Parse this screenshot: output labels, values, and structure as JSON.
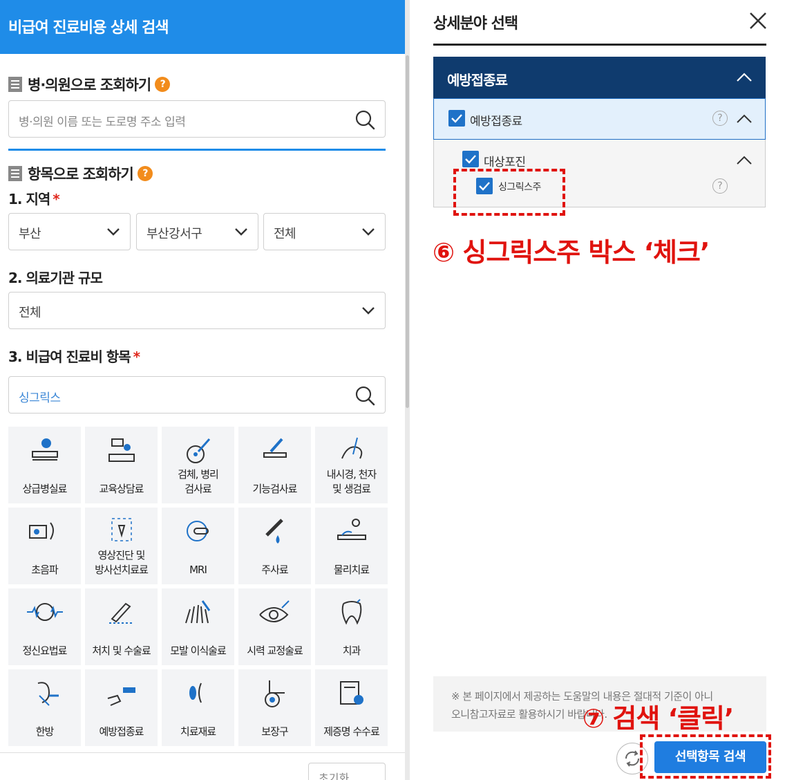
{
  "header": {
    "title": "비급여 진료비용 상세 검색"
  },
  "section1": {
    "title": "병·의원으로 조회하기",
    "help": "?",
    "search_placeholder": "병·의원 이름 또는 도로명 주소 입력"
  },
  "section2": {
    "title": "항목으로 조회하기",
    "help": "?",
    "region_label": "1. 지역",
    "required": "*",
    "region_selects": [
      "부산",
      "부산강서구",
      "전체"
    ],
    "scale_label": "2. 의료기관 규모",
    "scale_value": "전체",
    "item_label": "3. 비급여 진료비 항목",
    "item_value": "싱그릭스"
  },
  "categories": [
    {
      "label": "상급병실료",
      "icon": "bed-icon"
    },
    {
      "label": "교육상담료",
      "icon": "consult-icon"
    },
    {
      "label": "검체, 병리\n검사료",
      "icon": "specimen-icon"
    },
    {
      "label": "기능검사료",
      "icon": "function-test-icon"
    },
    {
      "label": "내시경, 천자\n및 생검료",
      "icon": "endoscope-icon"
    },
    {
      "label": "초음파",
      "icon": "ultrasound-icon"
    },
    {
      "label": "영상진단 및\n방사선치료료",
      "icon": "xray-icon"
    },
    {
      "label": "MRI",
      "icon": "mri-icon"
    },
    {
      "label": "주사료",
      "icon": "syringe-icon"
    },
    {
      "label": "물리치료",
      "icon": "physio-icon"
    },
    {
      "label": "정신요법료",
      "icon": "brain-icon"
    },
    {
      "label": "처치 및 수술료",
      "icon": "surgery-icon"
    },
    {
      "label": "모발 이식술료",
      "icon": "hair-icon"
    },
    {
      "label": "시력 교정술료",
      "icon": "eye-icon"
    },
    {
      "label": "치과",
      "icon": "tooth-icon"
    },
    {
      "label": "한방",
      "icon": "acupuncture-icon"
    },
    {
      "label": "예방접종료",
      "icon": "vaccine-icon"
    },
    {
      "label": "치료재료",
      "icon": "lens-icon"
    },
    {
      "label": "보장구",
      "icon": "wheelchair-icon"
    },
    {
      "label": "제증명 수수료",
      "icon": "certificate-icon"
    }
  ],
  "reset_label": "초기화",
  "panel": {
    "title": "상세분야 선택",
    "category": "예방접종료",
    "sub1": "예방접종료",
    "sub2": "대상포진",
    "sub3": "싱그릭스주",
    "help": "?",
    "notice": "※ 본 페이지에서 제공하는 도움말의 내용은 절대적 기준이 아니\n오니참고자료로 활용하시기 바랍니다.",
    "search_button": "선택항목 검색"
  },
  "annotations": {
    "step6": "⑥ 싱그릭스주 박스 ‘체크’",
    "step7": "⑦ 검색 ‘클릭’"
  },
  "colors": {
    "brand": "#1f8ce8",
    "navy": "#0f3b6e",
    "annotation": "#e0130e"
  }
}
